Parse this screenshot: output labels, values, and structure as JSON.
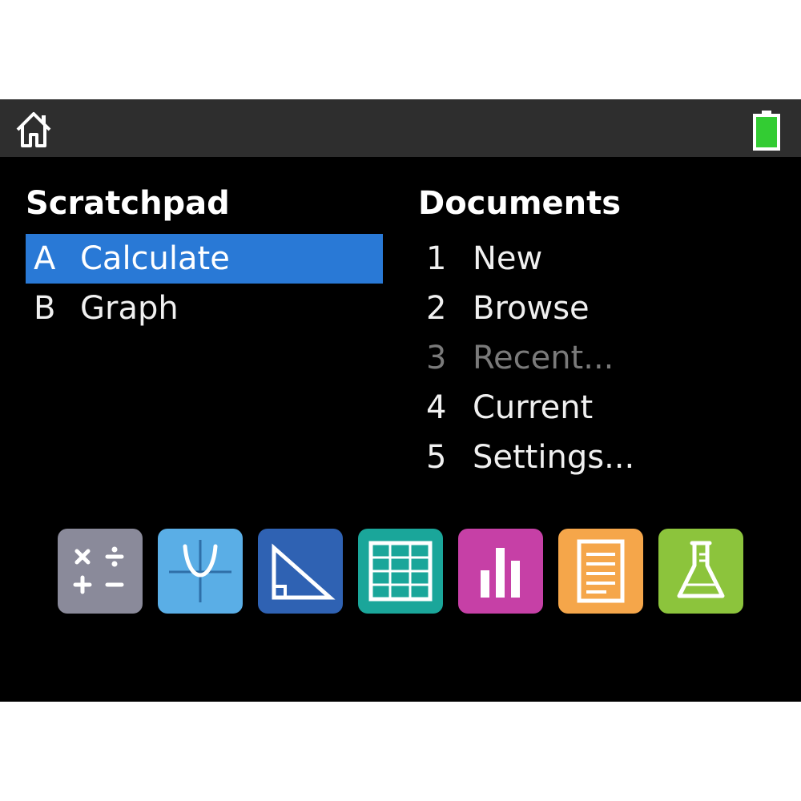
{
  "topbar": {
    "home_icon": "home-icon",
    "battery_icon": "battery-icon",
    "battery_color": "#33cc33"
  },
  "scratchpad": {
    "heading": "Scratchpad",
    "items": [
      {
        "key": "A",
        "label": "Calculate",
        "selected": true
      },
      {
        "key": "B",
        "label": "Graph",
        "selected": false
      }
    ]
  },
  "documents": {
    "heading": "Documents",
    "items": [
      {
        "key": "1",
        "label": "New",
        "disabled": false
      },
      {
        "key": "2",
        "label": "Browse",
        "disabled": false
      },
      {
        "key": "3",
        "label": "Recent...",
        "disabled": true
      },
      {
        "key": "4",
        "label": "Current",
        "disabled": false
      },
      {
        "key": "5",
        "label": "Settings...",
        "disabled": false
      }
    ]
  },
  "apps": [
    {
      "icon": "calculator-icon",
      "color": "#8a8a9a"
    },
    {
      "icon": "graphs-icon",
      "color": "#5aaee6"
    },
    {
      "icon": "geometry-icon",
      "color": "#2f62b3"
    },
    {
      "icon": "lists-spreadsheet-icon",
      "color": "#1aa69a"
    },
    {
      "icon": "data-statistics-icon",
      "color": "#c640a6"
    },
    {
      "icon": "notes-icon",
      "color": "#f5a64a"
    },
    {
      "icon": "vernier-dataquest-icon",
      "color": "#8cc43c"
    }
  ],
  "colors": {
    "selection": "#2979d6",
    "disabled_text": "#7a7a7a",
    "topbar": "#2e2e2e"
  }
}
